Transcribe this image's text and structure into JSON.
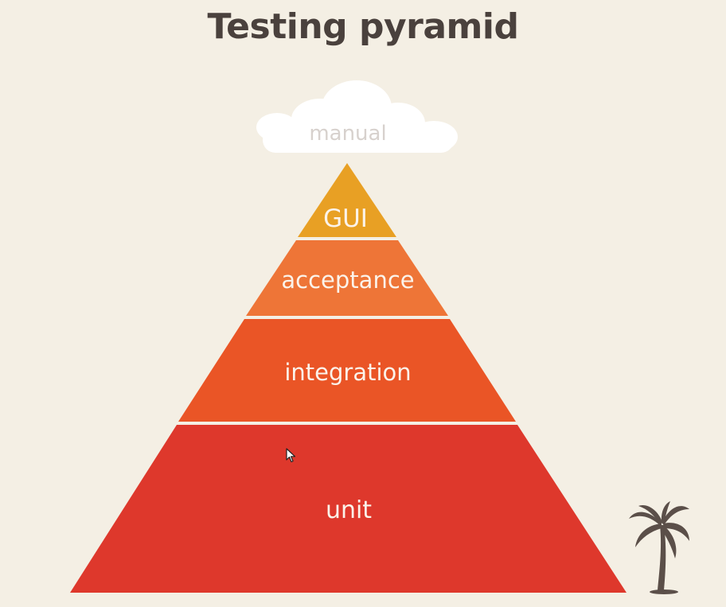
{
  "title": "Testing pyramid",
  "cloud": {
    "label": "manual",
    "color": "#ffffff",
    "label_color": "#d7d1cd"
  },
  "layers": [
    {
      "label": "GUI",
      "color": "#e8a024"
    },
    {
      "label": "acceptance",
      "color": "#ee7537"
    },
    {
      "label": "integration",
      "color": "#ea5526"
    },
    {
      "label": "unit",
      "color": "#de382c"
    }
  ],
  "colors": {
    "background": "#f4efe4",
    "title": "#4a413d",
    "label": "#fbf3ea",
    "tree": "#5b4f49"
  },
  "decorations": {
    "tree_icon": "palm-tree-icon",
    "cursor_icon": "mouse-cursor-icon"
  }
}
